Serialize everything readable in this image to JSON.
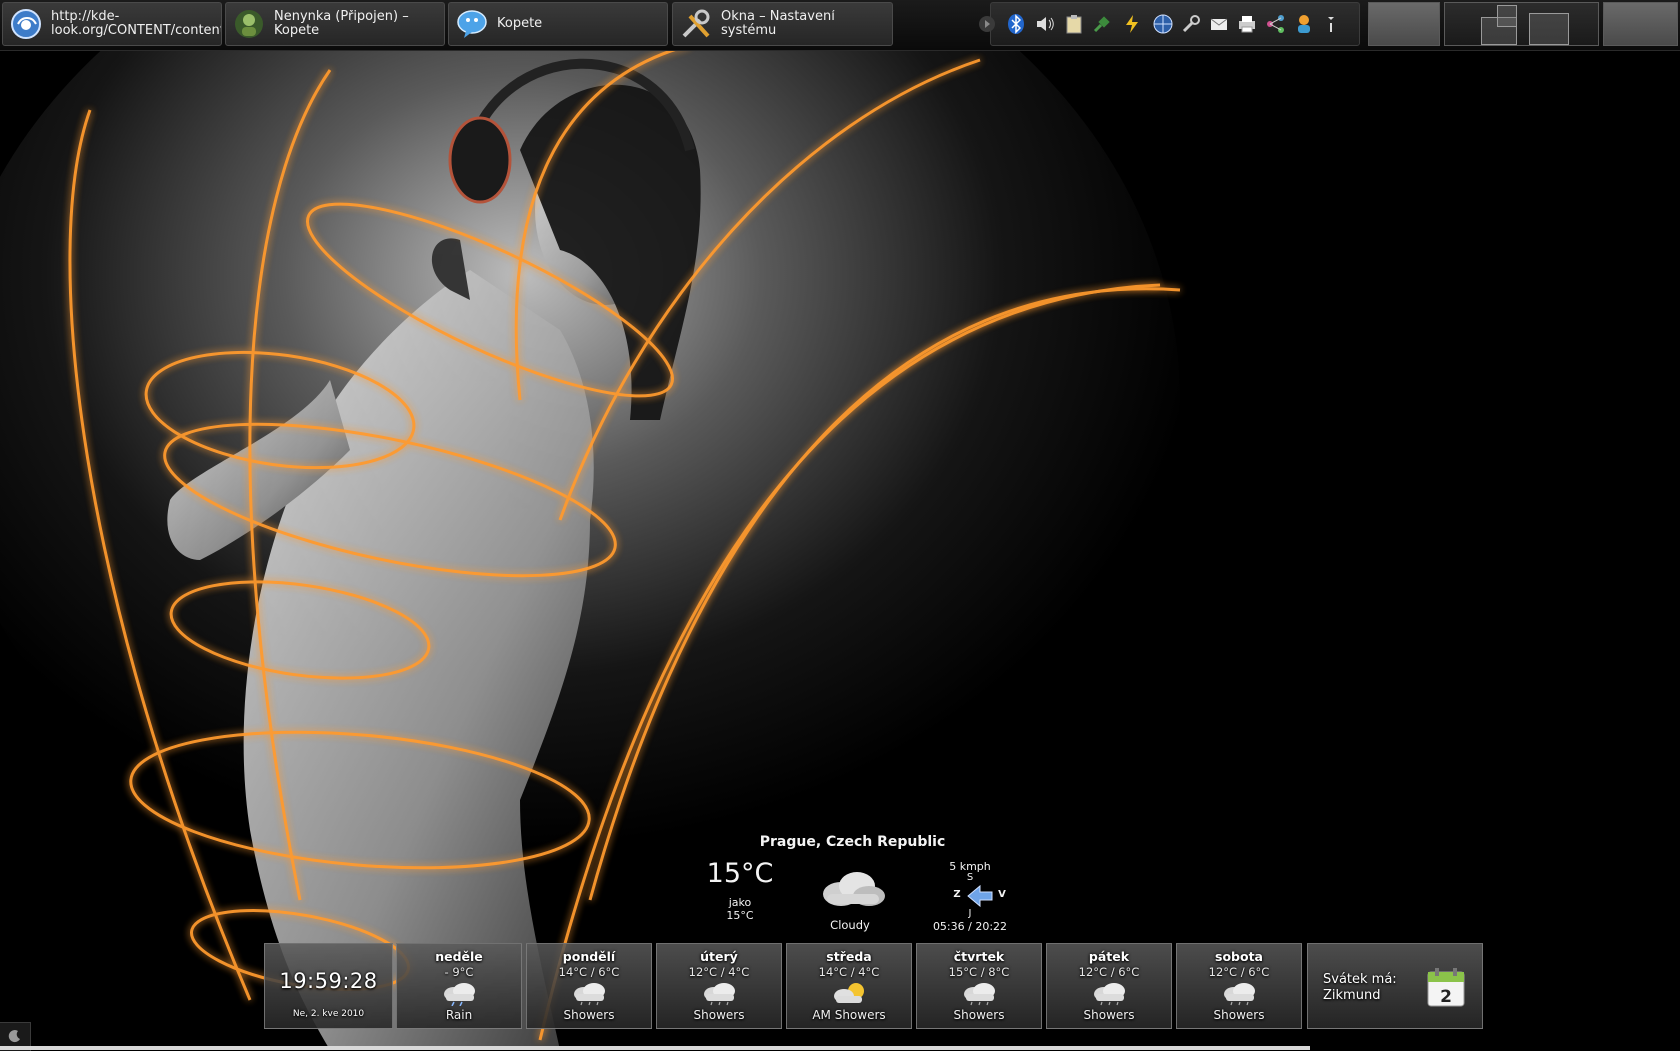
{
  "taskbar": {
    "tasks": [
      {
        "label": "http://kde-\nlook.org/CONTENT/content",
        "icon": "browser-globe-icon"
      },
      {
        "label": "Nenynka (Připojen) –\nKopete",
        "icon": "contact-avatar-icon"
      },
      {
        "label": "Kopete",
        "icon": "kopete-chat-icon"
      },
      {
        "label": "Okna – Nastavení systému",
        "icon": "system-settings-tools-icon"
      }
    ]
  },
  "tray": {
    "icons": [
      "arrow-expand-icon",
      "bluetooth-icon",
      "volume-icon",
      "clipboard-icon",
      "network-plug-icon",
      "power-icon",
      "network-globe-icon",
      "wrench-icon",
      "mail-icon",
      "printer-icon",
      "share-icon",
      "user-icon",
      "more-menu-icon"
    ]
  },
  "weather": {
    "location": "Prague, Czech Republic",
    "temperature": "15°C",
    "feels_like_label": "jako",
    "feels_like": "15°C",
    "condition": "Cloudy",
    "wind_speed": "5 kmph",
    "compass": {
      "north": "S",
      "west": "Z",
      "east": "V",
      "south": "J"
    },
    "sun_times": "05:36 / 20:22",
    "forecast": [
      {
        "day": "neděle",
        "temps": "- 9°C",
        "condition": "Rain",
        "icon": "rain-cloud-icon"
      },
      {
        "day": "pondělí",
        "temps": "14°C / 6°C",
        "condition": "Showers",
        "icon": "showers-cloud-icon"
      },
      {
        "day": "úterý",
        "temps": "12°C / 4°C",
        "condition": "Showers",
        "icon": "showers-cloud-icon"
      },
      {
        "day": "středa",
        "temps": "14°C / 4°C",
        "condition": "AM Showers",
        "icon": "sun-cloud-icon"
      },
      {
        "day": "čtvrtek",
        "temps": "15°C / 8°C",
        "condition": "Showers",
        "icon": "showers-cloud-icon"
      },
      {
        "day": "pátek",
        "temps": "12°C / 6°C",
        "condition": "Showers",
        "icon": "showers-cloud-icon"
      },
      {
        "day": "sobota",
        "temps": "12°C / 6°C",
        "condition": "Showers",
        "icon": "showers-cloud-icon"
      }
    ]
  },
  "clock": {
    "time": "19:59:28",
    "date": "Ne, 2. kve 2010"
  },
  "nameday": {
    "label": "Svátek má:",
    "name": "Zikmund",
    "calendar_day": "2"
  },
  "colors": {
    "glow": "#ff9a2e",
    "panel": "#1b1b1b",
    "tile_border": "#828282"
  }
}
